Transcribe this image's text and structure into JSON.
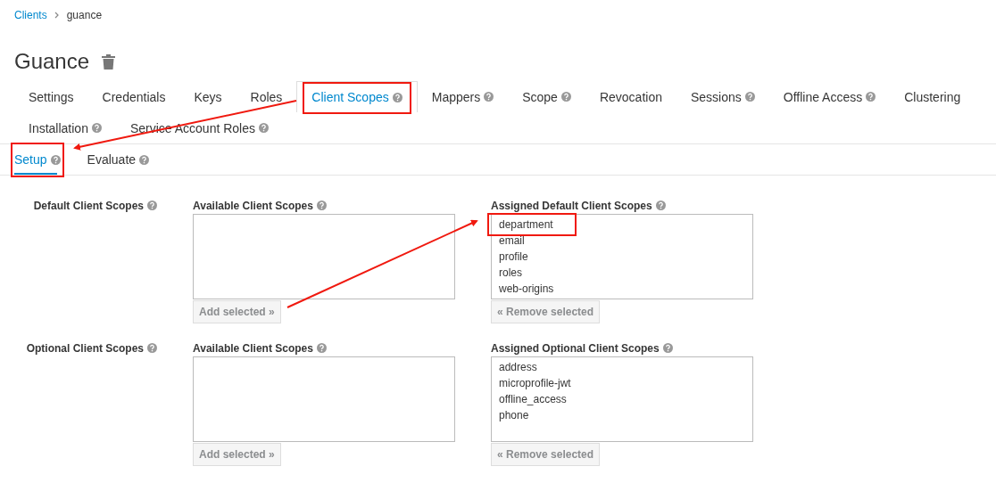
{
  "breadcrumb": [
    {
      "label": "Clients",
      "link": true
    },
    {
      "label": "guance",
      "link": false
    }
  ],
  "title": "Guance",
  "tab_rows": [
    [
      {
        "label": "Settings",
        "help": false,
        "selected": false,
        "highlighted": false
      },
      {
        "label": "Credentials",
        "help": false,
        "selected": false,
        "highlighted": false
      },
      {
        "label": "Keys",
        "help": false,
        "selected": false,
        "highlighted": false
      },
      {
        "label": "Roles",
        "help": false,
        "selected": false,
        "highlighted": false
      },
      {
        "label": "Client Scopes",
        "help": true,
        "selected": true,
        "highlighted": true
      },
      {
        "label": "Mappers",
        "help": true,
        "selected": false,
        "highlighted": false
      },
      {
        "label": "Scope",
        "help": true,
        "selected": false,
        "highlighted": false
      },
      {
        "label": "Revocation",
        "help": false,
        "selected": false,
        "highlighted": false
      },
      {
        "label": "Sessions",
        "help": true,
        "selected": false,
        "highlighted": false
      },
      {
        "label": "Offline Access",
        "help": true,
        "selected": false,
        "highlighted": false
      },
      {
        "label": "Clustering",
        "help": false,
        "selected": false,
        "highlighted": false
      }
    ],
    [
      {
        "label": "Installation",
        "help": true,
        "selected": false,
        "highlighted": false
      },
      {
        "label": "Service Account Roles",
        "help": true,
        "selected": false,
        "highlighted": false
      }
    ]
  ],
  "subtabs": [
    {
      "label": "Setup",
      "selected": true,
      "highlighted": true
    },
    {
      "label": "Evaluate",
      "selected": false,
      "highlighted": false
    }
  ],
  "sections": [
    {
      "label": "Default Client Scopes",
      "available": {
        "title": "Available Client Scopes",
        "button": "Add selected »"
      },
      "assigned": {
        "title": "Assigned Default Client Scopes",
        "items": [
          {
            "label": "department",
            "highlighted": true
          },
          {
            "label": "email",
            "highlighted": false
          },
          {
            "label": "profile",
            "highlighted": false
          },
          {
            "label": "roles",
            "highlighted": false
          },
          {
            "label": "web-origins",
            "highlighted": false
          }
        ],
        "button": "« Remove selected"
      }
    },
    {
      "label": "Optional Client Scopes",
      "available": {
        "title": "Available Client Scopes",
        "button": "Add selected »"
      },
      "assigned": {
        "title": "Assigned Optional Client Scopes",
        "items": [
          {
            "label": "address",
            "highlighted": false
          },
          {
            "label": "microprofile-jwt",
            "highlighted": false
          },
          {
            "label": "offline_access",
            "highlighted": false
          },
          {
            "label": "phone",
            "highlighted": false
          }
        ],
        "button": "« Remove selected"
      }
    }
  ]
}
